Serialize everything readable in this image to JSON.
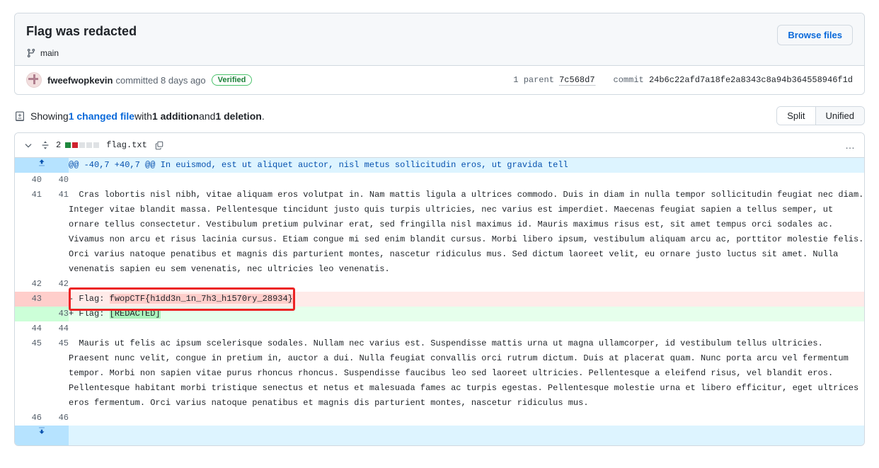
{
  "commit": {
    "title": "Flag was redacted",
    "branch": "main",
    "browse_files_label": "Browse files",
    "author": "fweefwopkevin",
    "committed_text": "committed 8 days ago",
    "verified_label": "Verified",
    "parent_label": "1 parent",
    "parent_sha": "7c568d7",
    "commit_label": "commit",
    "commit_sha": "24b6c22afd7a18fe2a8343c8a94b364558946f1d"
  },
  "showing": {
    "prefix": "Showing ",
    "changed_file_link": "1 changed file",
    "with_text": " with ",
    "additions": "1 addition",
    "and_text": " and ",
    "deletions": "1 deletion",
    "suffix": ".",
    "split_label": "Split",
    "unified_label": "Unified"
  },
  "file": {
    "changes_count": "2",
    "name": "flag.txt",
    "diffstat_squares": [
      "add",
      "del",
      "neutral",
      "neutral",
      "neutral"
    ]
  },
  "diff": {
    "hunk_header": "@@ -40,7 +40,7 @@ In euismod, est ut aliquet auctor, nisl metus sollicitudin eros, ut gravida tell",
    "rows": [
      {
        "type": "ctx",
        "old": "40",
        "new": "40",
        "text": ""
      },
      {
        "type": "ctx",
        "old": "41",
        "new": "41",
        "text": "  Cras lobortis nisl nibh, vitae aliquam eros volutpat in. Nam mattis ligula a ultrices commodo. Duis in diam in nulla tempor sollicitudin feugiat nec diam. Integer vitae blandit massa. Pellentesque tincidunt justo quis turpis ultricies, nec varius est imperdiet. Maecenas feugiat sapien a tellus semper, ut ornare tellus consectetur. Vestibulum pretium pulvinar erat, sed fringilla nisl maximus id. Mauris maximus risus est, sit amet tempus orci sodales ac. Vivamus non arcu et risus lacinia cursus. Etiam congue mi sed enim blandit cursus. Morbi libero ipsum, vestibulum aliquam arcu ac, porttitor molestie felis. Orci varius natoque penatibus et magnis dis parturient montes, nascetur ridiculus mus. Sed dictum laoreet velit, eu ornare justo luctus sit amet. Nulla venenatis sapien eu sem venenatis, nec ultricies leo venenatis."
      },
      {
        "type": "ctx",
        "old": "42",
        "new": "42",
        "text": ""
      },
      {
        "type": "del",
        "old": "43",
        "new": "",
        "marker": "- ",
        "plain": "Flag: ",
        "highlight": "fwopCTF{h1dd3n_1n_7h3_h1570ry_28934}"
      },
      {
        "type": "add",
        "old": "",
        "new": "43",
        "marker": "+ ",
        "plain": "Flag: ",
        "highlight": "[REDACTED]"
      },
      {
        "type": "ctx",
        "old": "44",
        "new": "44",
        "text": ""
      },
      {
        "type": "ctx",
        "old": "45",
        "new": "45",
        "text": "  Mauris ut felis ac ipsum scelerisque sodales. Nullam nec varius est. Suspendisse mattis urna ut magna ullamcorper, id vestibulum tellus ultricies. Praesent nunc velit, congue in pretium in, auctor a dui. Nulla feugiat convallis orci rutrum dictum. Duis at placerat quam. Nunc porta arcu vel fermentum tempor. Morbi non sapien vitae purus rhoncus rhoncus. Suspendisse faucibus leo sed laoreet ultricies. Pellentesque a eleifend risus, vel blandit eros. Pellentesque habitant morbi tristique senectus et netus et malesuada fames ac turpis egestas. Pellentesque molestie urna et libero efficitur, eget ultrices eros fermentum. Orci varius natoque penatibus et magnis dis parturient montes, nascetur ridiculus mus."
      },
      {
        "type": "ctx",
        "old": "46",
        "new": "46",
        "text": ""
      }
    ]
  },
  "icons": {
    "branch": "git-branch-icon",
    "file_diff": "file-diff-icon",
    "expand_up": "expand-up-icon",
    "expand_down": "expand-down-icon",
    "kebab": "…"
  },
  "colors": {
    "accent": "#0969da",
    "addition": "#1f883d",
    "deletion": "#cf222e",
    "annotation": "#ec2324"
  }
}
